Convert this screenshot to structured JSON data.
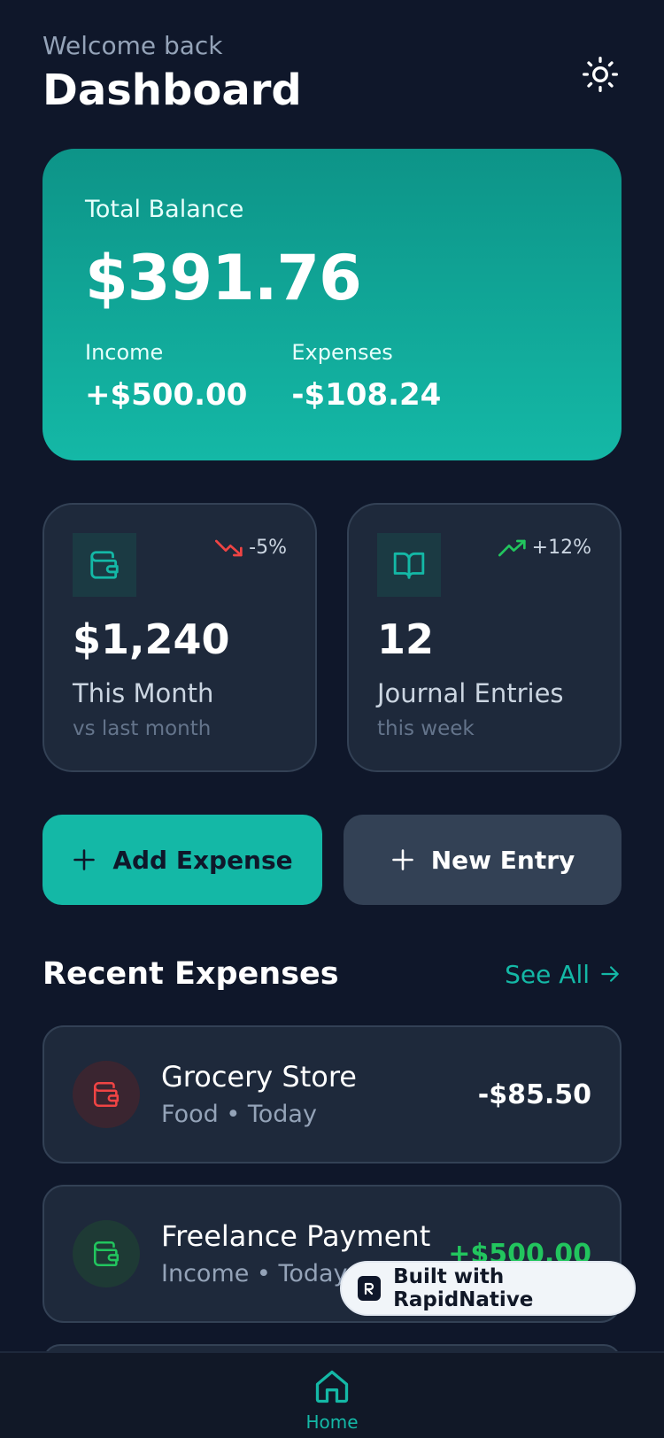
{
  "header": {
    "welcome": "Welcome back",
    "title": "Dashboard"
  },
  "balance": {
    "label": "Total Balance",
    "amount": "$391.76",
    "income_label": "Income",
    "income_value": "+$500.00",
    "expenses_label": "Expenses",
    "expenses_value": "-$108.24"
  },
  "stats": [
    {
      "icon": "wallet-icon",
      "trend": "-5%",
      "trend_direction": "down",
      "value": "$1,240",
      "label": "This Month",
      "sub": "vs last month"
    },
    {
      "icon": "book-icon",
      "trend": "+12%",
      "trend_direction": "up",
      "value": "12",
      "label": "Journal Entries",
      "sub": "this week"
    }
  ],
  "actions": {
    "add_expense": "Add Expense",
    "new_entry": "New Entry"
  },
  "recent": {
    "title": "Recent Expenses",
    "see_all": "See All",
    "items": [
      {
        "name": "Grocery Store",
        "meta": "Food • Today",
        "amount": "-$85.50",
        "color": "#ef4444"
      },
      {
        "name": "Freelance Payment",
        "meta": "Income • Today",
        "amount": "+$500.00",
        "color": "#22c55e"
      }
    ]
  },
  "nav": {
    "home": "Home"
  },
  "badge": {
    "text": "Built with RapidNative"
  },
  "colors": {
    "background": "#0f172a",
    "accent": "#14b8a6",
    "card": "#1e293b",
    "negative": "#ef4444",
    "positive": "#22c55e"
  }
}
